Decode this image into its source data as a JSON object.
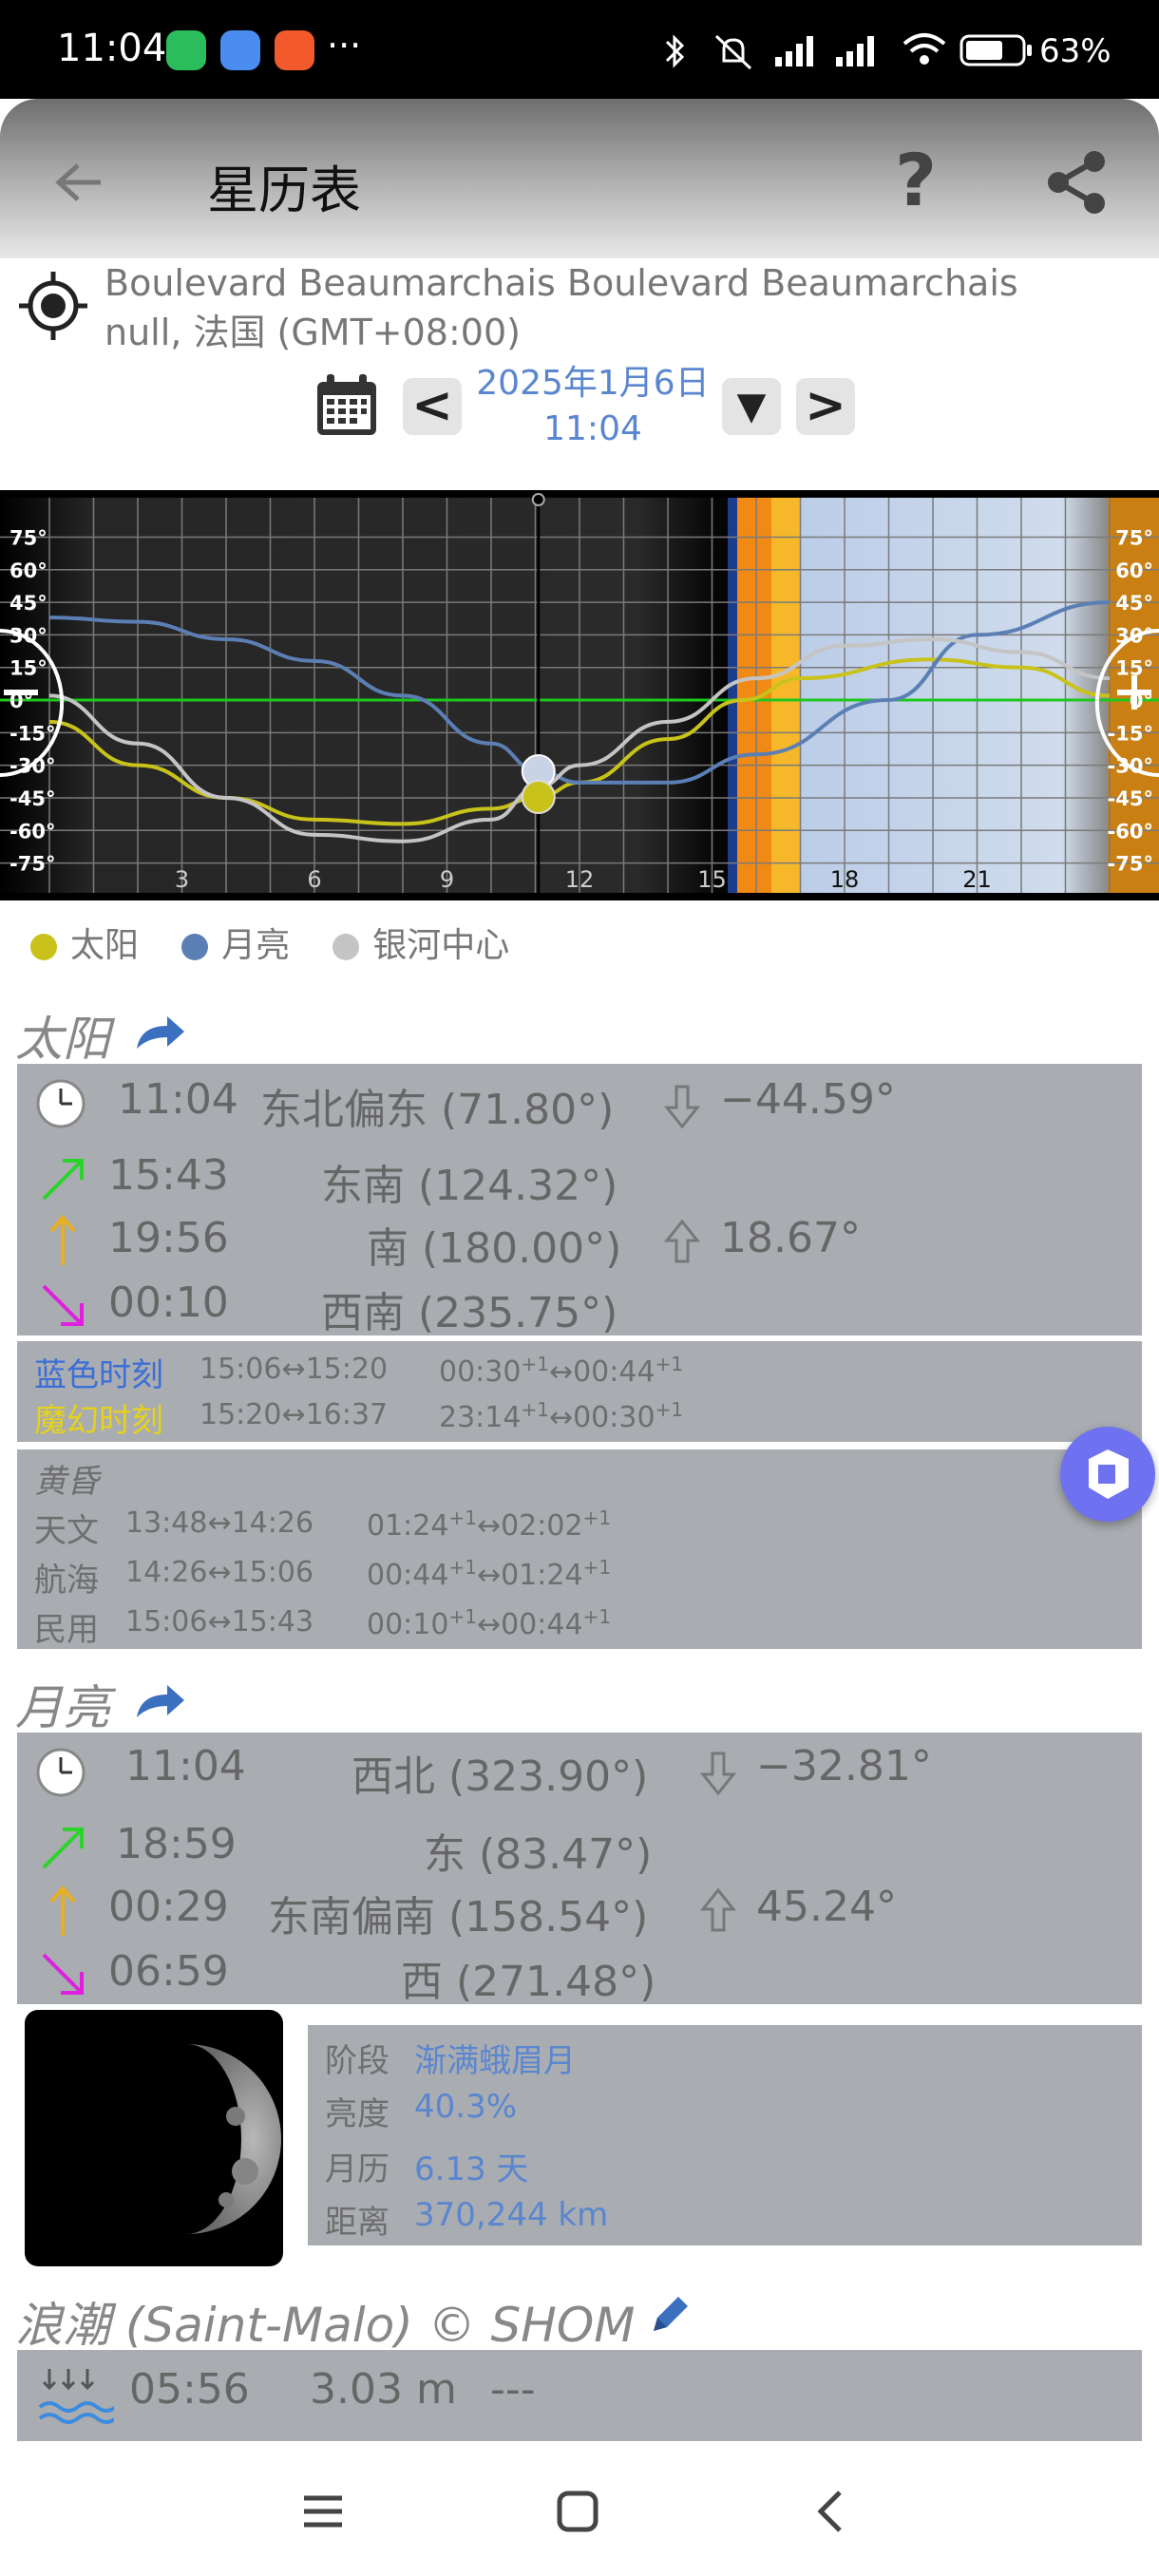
{
  "status_bar": {
    "time": "11:04",
    "more": "···",
    "battery": "63%"
  },
  "header": {
    "title": "星历表"
  },
  "location": {
    "line1": "Boulevard Beaumarchais Boulevard Beaumarchais",
    "line2": "null, 法国 (GMT+08:00)",
    "date": "2025年1月6日",
    "time": "11:04",
    "prev": "<",
    "next": ">",
    "dropdown": "▼"
  },
  "chart_data": {
    "type": "line",
    "x_ticks": [
      "3",
      "6",
      "9",
      "12",
      "15",
      "18",
      "21"
    ],
    "y_ticks": [
      "75°",
      "60°",
      "45°",
      "30°",
      "15°",
      "0°",
      "-15°",
      "-30°",
      "-45°",
      "-60°",
      "-75°"
    ],
    "xlim": [
      0,
      24
    ],
    "ylim": [
      -80,
      80
    ],
    "current_time": 11.07,
    "series": [
      {
        "name": "太阳",
        "color": "#c8c21a",
        "x": [
          0,
          2,
          4,
          6,
          8,
          10,
          11.07,
          12,
          14,
          15.7,
          17,
          19.93,
          22,
          24
        ],
        "y": [
          -10,
          -30,
          -45,
          -55,
          -57,
          -50,
          -44.6,
          -38,
          -18,
          0,
          10,
          18.7,
          15,
          2
        ]
      },
      {
        "name": "月亮",
        "color": "#5b7fb5",
        "x": [
          0,
          2,
          4,
          6,
          8,
          10,
          11.07,
          12,
          14,
          16,
          18.98,
          21,
          24
        ],
        "y": [
          38,
          36,
          28,
          18,
          2,
          -20,
          -32.8,
          -38,
          -38,
          -25,
          0,
          30,
          45
        ]
      },
      {
        "name": "银河中心",
        "color": "#c4c4c4",
        "x": [
          0,
          2,
          4,
          6,
          8,
          10,
          11.07,
          12,
          14,
          16,
          18,
          20,
          22,
          24
        ],
        "y": [
          2,
          -20,
          -45,
          -62,
          -65,
          -55,
          -40,
          -30,
          -10,
          10,
          25,
          28,
          22,
          10
        ]
      }
    ]
  },
  "legend": [
    {
      "label": "太阳",
      "color": "#c8c21a"
    },
    {
      "label": "月亮",
      "color": "#5b7fb5"
    },
    {
      "label": "银河中心",
      "color": "#c4c4c4"
    }
  ],
  "sun": {
    "title": "太阳",
    "now_time": "11:04",
    "now_dir": "东北偏东 (71.80°)",
    "now_alt": "−44.59°",
    "rise_time": "15:43",
    "rise_dir": "东南 (124.32°)",
    "transit_time": "19:56",
    "transit_dir": "南 (180.00°)",
    "transit_alt": "18.67°",
    "set_time": "00:10",
    "set_dir": "西南 (235.75°)",
    "blue_hour_label": "蓝色时刻",
    "blue_hour_1": "15:06↔15:20",
    "blue_hour_2a": "00:30",
    "blue_hour_2b": "00:44",
    "golden_hour_label": "魔幻时刻",
    "golden_hour_1": "15:20↔16:37",
    "golden_hour_2a": "23:14",
    "golden_hour_2b": "00:30",
    "twilight_title": "黄昏",
    "astro_label": "天文",
    "astro_1": "13:48↔14:26",
    "astro_2a": "01:24",
    "astro_2b": "02:02",
    "naut_label": "航海",
    "naut_1": "14:26↔15:06",
    "naut_2a": "00:44",
    "naut_2b": "01:24",
    "civil_label": "民用",
    "civil_1": "15:06↔15:43",
    "civil_2a": "00:10",
    "civil_2b": "00:44",
    "plus1": "+1",
    "arrow": "↔"
  },
  "moon": {
    "title": "月亮",
    "now_time": "11:04",
    "now_dir": "西北 (323.90°)",
    "now_alt": "−32.81°",
    "rise_time": "18:59",
    "rise_dir": "东 (83.47°)",
    "transit_time": "00:29",
    "transit_dir": "东南偏南 (158.54°)",
    "transit_alt": "45.24°",
    "set_time": "06:59",
    "set_dir": "西 (271.48°)",
    "phase_label": "阶段",
    "phase_value": "渐满蛾眉月",
    "illum_label": "亮度",
    "illum_value": "40.3%",
    "age_label": "月历",
    "age_value": "6.13 天",
    "dist_label": "距离",
    "dist_value": "370,244 km"
  },
  "tide": {
    "title": "浪潮 (Saint-Malo) © SHOM",
    "time": "05:56",
    "height": "3.03 m",
    "extra": "---"
  }
}
